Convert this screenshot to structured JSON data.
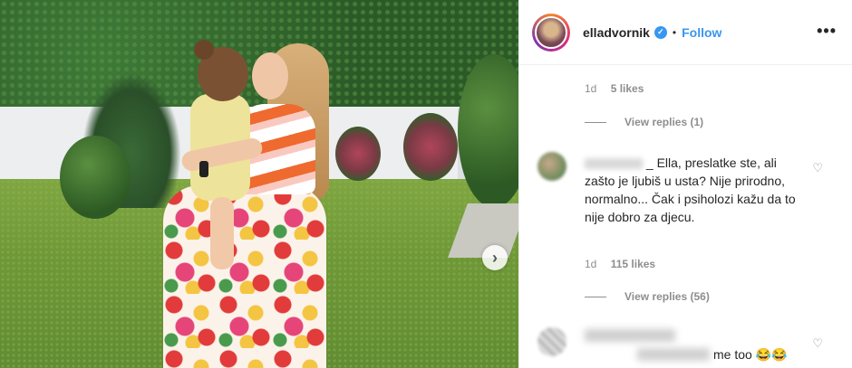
{
  "post": {
    "username": "elladvornik",
    "verified_mark": "✓",
    "separator": "•",
    "follow_label": "Follow",
    "more_label": "•••",
    "photo_next_icon": "chevron-right-icon",
    "photo_next_glyph": "›"
  },
  "comments": {
    "first": {
      "age": "1d",
      "likes": "5 likes",
      "view_replies": "View replies (1)"
    },
    "second": {
      "text": "_ Ella, preslatke ste, ali zašto je ljubiš u usta? Nije prirodno, normalno... Čak i psiholozi kažu da to nije dobro za djecu.",
      "age": "1d",
      "likes": "115 likes",
      "view_replies": "View replies (56)",
      "heart_glyph": "♡"
    },
    "third": {
      "text": "me too 😂😂",
      "heart_glyph": "♡"
    }
  },
  "colors": {
    "accent": "#3897f0",
    "muted": "#8e8e8e",
    "text": "#262626"
  }
}
